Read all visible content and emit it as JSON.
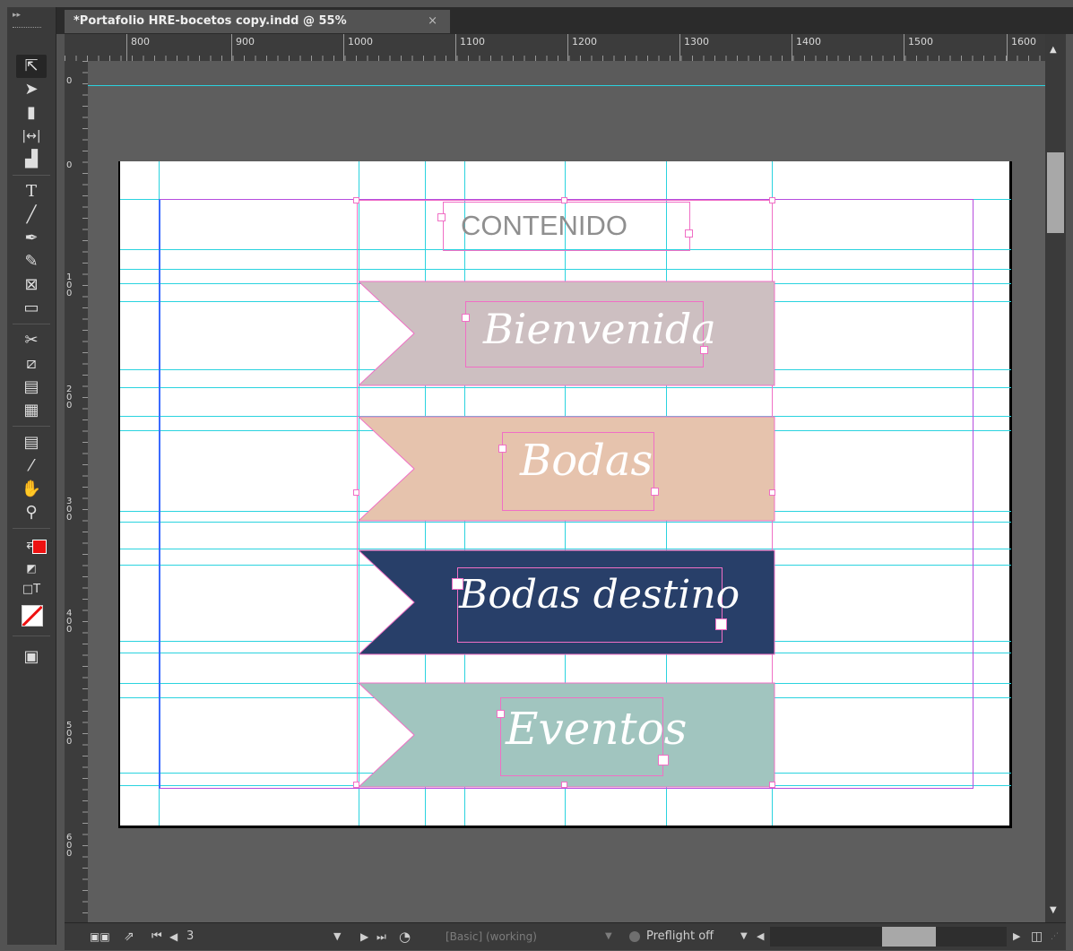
{
  "document": {
    "tab_title": "*Portafolio HRE-bocetos copy.indd @ 55%",
    "close_glyph": "×",
    "zoom": "55%"
  },
  "rulers": {
    "horizontal": [
      "800",
      "900",
      "1000",
      "1100",
      "1200",
      "1300",
      "1400",
      "1500",
      "1600"
    ],
    "vertical": [
      "0",
      "0",
      "100",
      "200",
      "300",
      "400",
      "500",
      "600"
    ]
  },
  "page_content": {
    "heading": "CONTENIDO",
    "banners": [
      {
        "label": "Bienvenida",
        "color": "#cdbfc1"
      },
      {
        "label": "Bodas",
        "color": "#e6c3ad"
      },
      {
        "label": "Bodas destino",
        "color": "#283f69"
      },
      {
        "label": "Eventos",
        "color": "#a1c5bf"
      }
    ]
  },
  "status_bar": {
    "page_number": "3",
    "preset": "[Basic] (working)",
    "preflight": "Preflight off"
  },
  "colors": {
    "guide": "#2ad3df",
    "frame": "#f06fc5",
    "margin": "#b64cde"
  },
  "tools": [
    "selection-tool",
    "direct-selection-tool",
    "page-tool",
    "gap-tool",
    "content-collector-tool",
    "type-tool",
    "line-tool",
    "pen-tool",
    "pencil-tool",
    "rectangle-frame-tool",
    "rectangle-tool",
    "scissors-tool",
    "free-transform-tool",
    "gradient-swatch-tool",
    "gradient-feather-tool",
    "note-tool",
    "eyedropper-tool",
    "hand-tool",
    "zoom-tool",
    "fill-stroke-swap",
    "default-fill-stroke",
    "formatting-affects",
    "apply-none",
    "screen-mode"
  ]
}
